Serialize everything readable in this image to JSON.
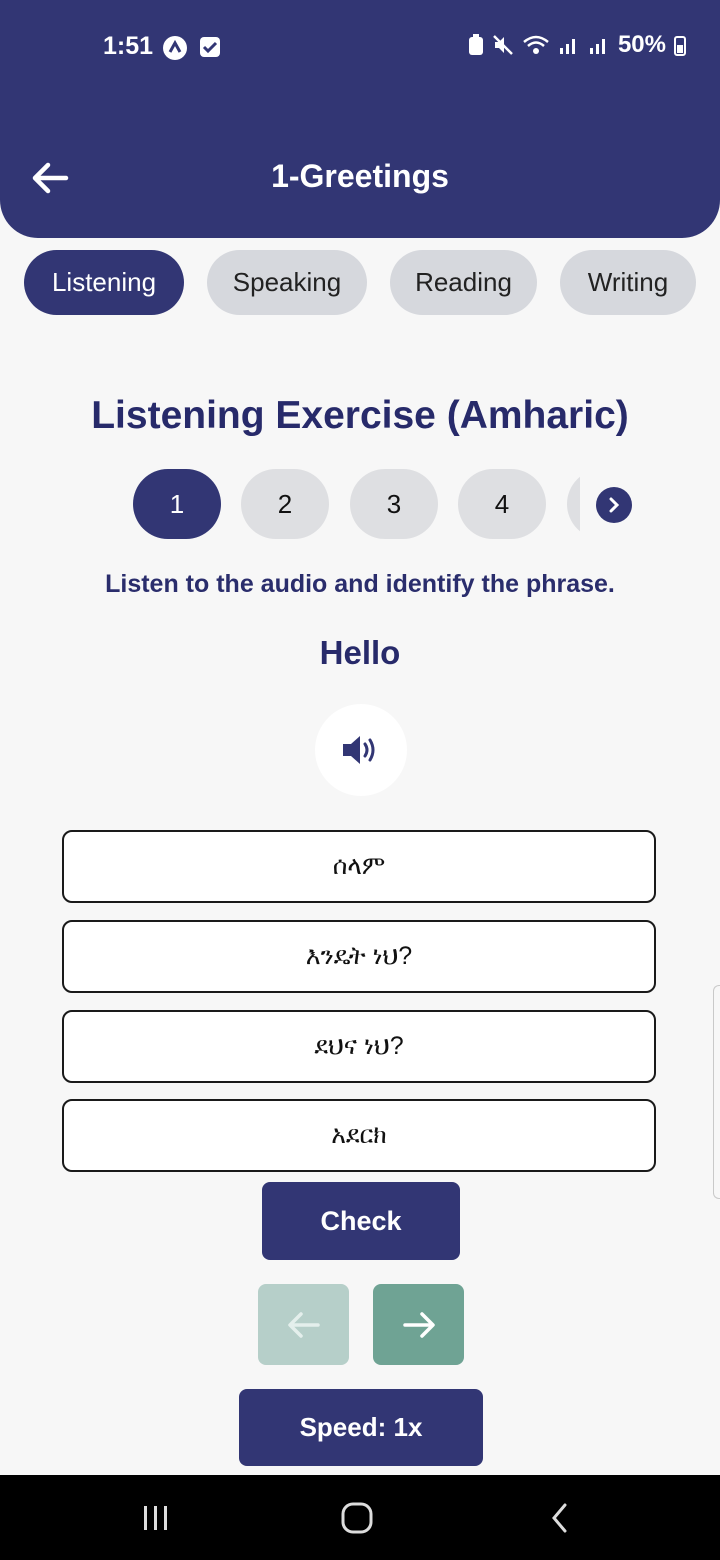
{
  "status_bar": {
    "time": "1:51",
    "battery": "50%"
  },
  "header": {
    "title": "1-Greetings"
  },
  "tabs": [
    {
      "label": "Listening",
      "active": true
    },
    {
      "label": "Speaking",
      "active": false
    },
    {
      "label": "Reading",
      "active": false
    },
    {
      "label": "Writing",
      "active": false
    }
  ],
  "exercise": {
    "title": "Listening Exercise (Amharic)",
    "questions": [
      "1",
      "2",
      "3",
      "4"
    ],
    "current_question": "1",
    "instruction": "Listen to the audio and identify the phrase.",
    "prompt_word": "Hello",
    "options": [
      "ሰላም",
      "እንዴት ነህ?",
      "ደህና ነህ?",
      "አደርክ"
    ]
  },
  "buttons": {
    "check": "Check",
    "speed": "Speed: 1x"
  },
  "colors": {
    "primary": "#323674",
    "next_green": "#6fa394",
    "prev_disabled": "#b6cfc9",
    "tab_inactive": "#d6d8dd"
  },
  "icons": {
    "back": "arrow-left-icon",
    "audio": "speaker-icon",
    "next_question": "chevron-right-icon",
    "prev": "arrow-left-icon",
    "next": "arrow-right-icon"
  }
}
